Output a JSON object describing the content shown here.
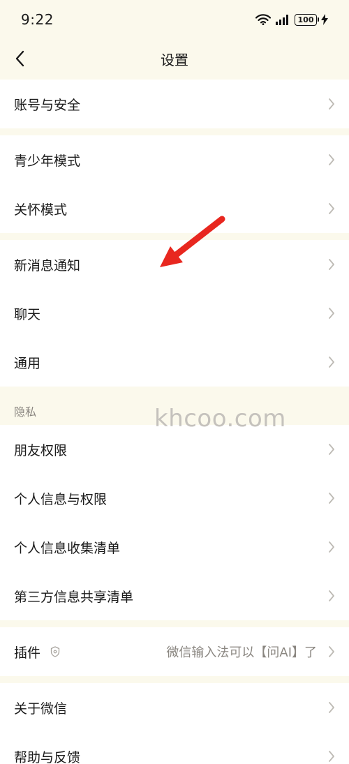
{
  "status_bar": {
    "time": "9:22",
    "battery": "100"
  },
  "nav": {
    "title": "设置"
  },
  "groups": {
    "account": {
      "items": [
        {
          "label": "账号与安全"
        }
      ]
    },
    "modes": {
      "items": [
        {
          "label": "青少年模式"
        },
        {
          "label": "关怀模式"
        }
      ]
    },
    "general": {
      "items": [
        {
          "label": "新消息通知"
        },
        {
          "label": "聊天"
        },
        {
          "label": "通用"
        }
      ]
    },
    "privacy": {
      "section_label": "隐私",
      "items": [
        {
          "label": "朋友权限"
        },
        {
          "label": "个人信息与权限"
        },
        {
          "label": "个人信息收集清单"
        },
        {
          "label": "第三方信息共享清单"
        }
      ]
    },
    "plugins": {
      "items": [
        {
          "label": "插件",
          "value": "微信输入法可以【问AI】了"
        }
      ]
    },
    "about": {
      "items": [
        {
          "label": "关于微信"
        },
        {
          "label": "帮助与反馈"
        }
      ]
    }
  },
  "watermark": "khcoo.com",
  "colors": {
    "background": "#fbf9ec",
    "card": "#ffffff",
    "chevron": "#bdbab4",
    "annotation_arrow": "#e8271f"
  },
  "icons": {
    "back": "chevron-left-icon",
    "row_arrow": "chevron-right-icon",
    "plugin_badge": "shield-badge-icon",
    "wifi": "wifi-icon",
    "signal": "signal-icon",
    "charging": "bolt-icon"
  }
}
